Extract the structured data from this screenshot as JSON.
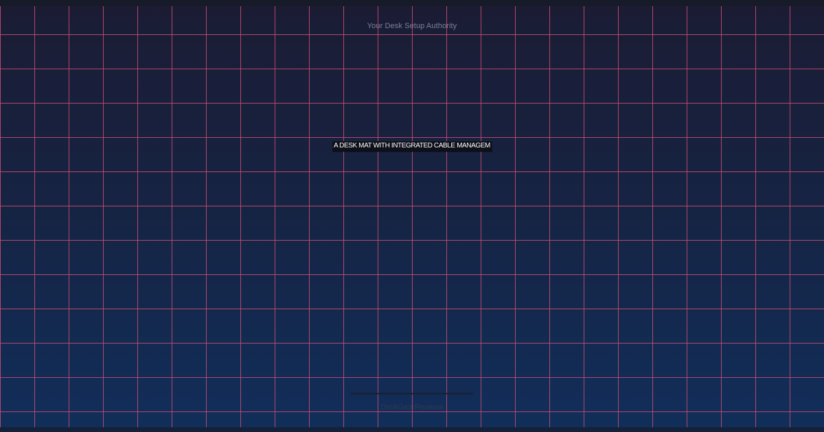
{
  "banner": {
    "tagline": "Your Desk Setup Authority",
    "headline": "A DESK MAT WITH INTEGRATED CABLE MANAGEM",
    "brand": "DeskGearReviews"
  },
  "colors": {
    "background_top": "#1b1c34",
    "background_bottom": "#112e5a",
    "grid_lines": "#d24d73",
    "headline_bg": "#0d0f19",
    "headline_text": "#ffffff",
    "tagline_text": "#7c8196",
    "brand_text": "#2f3a55"
  }
}
